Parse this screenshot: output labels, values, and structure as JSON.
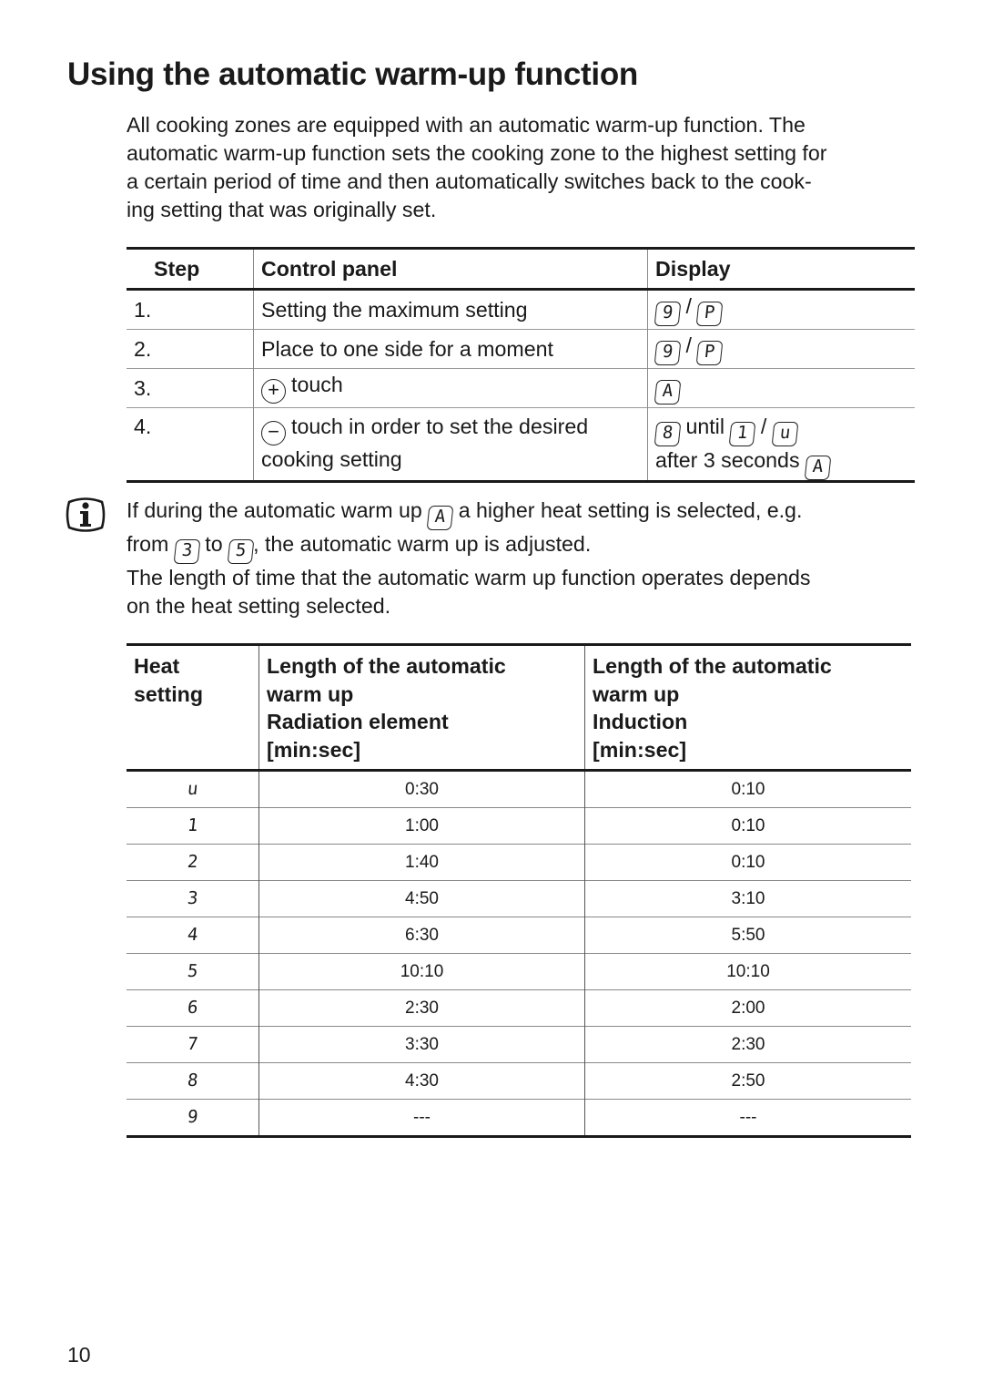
{
  "title": "Using the automatic warm-up function",
  "intro_lines": [
    "All cooking zones are equipped with an automatic warm-up function. The",
    "automatic warm-up function sets the cooking zone to the highest setting for",
    "a certain period of time and then automatically switches back to the cook-",
    "ing setting that was originally set."
  ],
  "steps_table": {
    "headers": [
      "Step",
      "Control panel",
      "Display"
    ],
    "rows": [
      {
        "step": "1.",
        "control": "Setting the maximum setting",
        "display": {
          "a": "9",
          "sep": "/",
          "b": "P"
        }
      },
      {
        "step": "2.",
        "control": "Place to one side for a moment",
        "display": {
          "a": "9",
          "sep": "/",
          "b": "P"
        }
      },
      {
        "step": "3.",
        "control_icon": "plus-circle-icon",
        "control_symbol": "+",
        "control": "touch",
        "display": {
          "a": "A"
        }
      },
      {
        "step": "4.",
        "control_icon": "minus-circle-icon",
        "control_symbol": "−",
        "control_line1": "touch in order to set the desired",
        "control_line2": "cooking setting",
        "display": {
          "a": "8",
          "until": "until",
          "b": "1",
          "sep": "/",
          "c": "u",
          "after": "after 3 seconds",
          "d": "A"
        }
      }
    ]
  },
  "note": {
    "icon": "info-icon",
    "line1_a": "If during the automatic warm up",
    "line1_seg": "A",
    "line1_b": "a higher heat setting is selected, e.g.",
    "line2_a": "from",
    "line2_seg1": "3",
    "line2_b": "to",
    "line2_seg2": "5",
    "line2_c": ", the automatic warm up is adjusted.",
    "line3": "The length of time that the automatic warm up function operates depends",
    "line4": "on the heat setting selected."
  },
  "warmup_table": {
    "headers": [
      [
        "Heat",
        "setting"
      ],
      [
        "Length of the automatic",
        "warm up",
        "Radiation element",
        "[min:sec]"
      ],
      [
        "Length of the automatic",
        "warm up",
        "Induction",
        "[min:sec]"
      ]
    ],
    "rows": [
      {
        "setting": "u",
        "radiation": "0:30",
        "induction": "0:10"
      },
      {
        "setting": "1",
        "radiation": "1:00",
        "induction": "0:10"
      },
      {
        "setting": "2",
        "radiation": "1:40",
        "induction": "0:10"
      },
      {
        "setting": "3",
        "radiation": "4:50",
        "induction": "3:10"
      },
      {
        "setting": "4",
        "radiation": "6:30",
        "induction": "5:50"
      },
      {
        "setting": "5",
        "radiation": "10:10",
        "induction": "10:10"
      },
      {
        "setting": "6",
        "radiation": "2:30",
        "induction": "2:00"
      },
      {
        "setting": "7",
        "radiation": "3:30",
        "induction": "2:30"
      },
      {
        "setting": "8",
        "radiation": "4:30",
        "induction": "2:50"
      },
      {
        "setting": "9",
        "radiation": "---",
        "induction": "---"
      }
    ]
  },
  "page_number": "10"
}
